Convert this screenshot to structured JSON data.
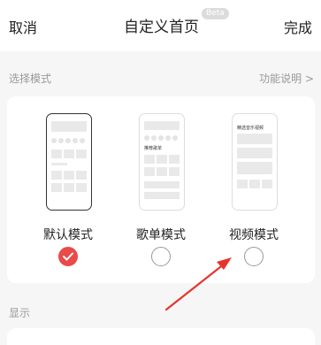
{
  "header": {
    "cancel_label": "取消",
    "title": "自定义首页",
    "beta_badge": "Beta",
    "done_label": "完成"
  },
  "mode_section": {
    "label": "选择模式",
    "help_link": "功能说明 >"
  },
  "modes": [
    {
      "label": "默认模式",
      "selected": true
    },
    {
      "label": "歌单模式",
      "selected": false,
      "preview_text": "推荐歌单"
    },
    {
      "label": "视频模式",
      "selected": false,
      "preview_text": "精选音乐视频"
    }
  ],
  "display_section": {
    "label": "显示"
  },
  "colors": {
    "accent": "#e94a4a",
    "annotation_arrow": "#e8332d"
  },
  "icons": [
    "check-icon",
    "arrow-annotation"
  ]
}
